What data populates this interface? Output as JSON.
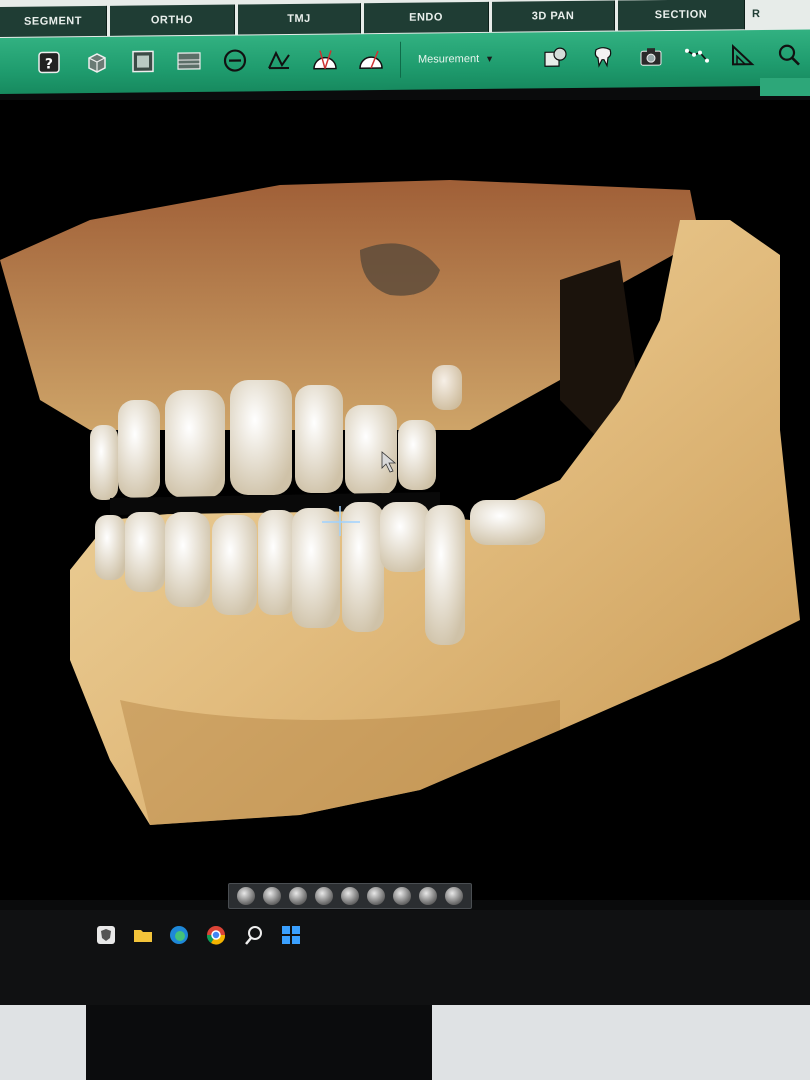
{
  "tabs": {
    "segment": "SEGMENT",
    "ortho": "ORTHO",
    "tmj": "TMJ",
    "endo": "ENDO",
    "pan3d": "3D PAN",
    "section": "SECTION",
    "partial": "R"
  },
  "toolbar": {
    "measure_label": "Mesurement",
    "icons": [
      "help-icon",
      "cube-icon",
      "slice-icon",
      "film-icon",
      "circle-minus-icon",
      "angle-icon",
      "protractor-icon",
      "protractor2-icon",
      "dropdown-icon",
      "export-icon",
      "tooth-icon",
      "camera-icon",
      "polyline-icon",
      "ruler-triangle-icon",
      "zoom-icon"
    ]
  },
  "colors": {
    "toolbar_green": "#1f9c6e",
    "tab_dark": "#1f3d34",
    "bone": "#e6c38a"
  }
}
